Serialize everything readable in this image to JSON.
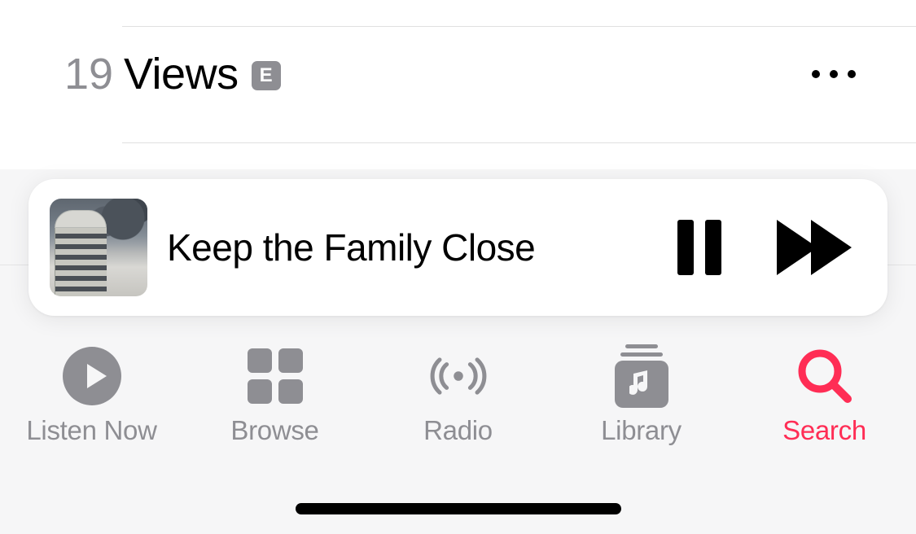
{
  "tracklist": {
    "visible_track": {
      "number": "19",
      "title": "Views",
      "explicit_label": "E"
    }
  },
  "now_playing": {
    "title": "Keep the Family Close"
  },
  "tabs": {
    "listen_now": "Listen Now",
    "browse": "Browse",
    "radio": "Radio",
    "library": "Library",
    "search": "Search",
    "active": "search"
  },
  "colors": {
    "inactive": "#8e8e93",
    "active": "#ff2d55"
  }
}
